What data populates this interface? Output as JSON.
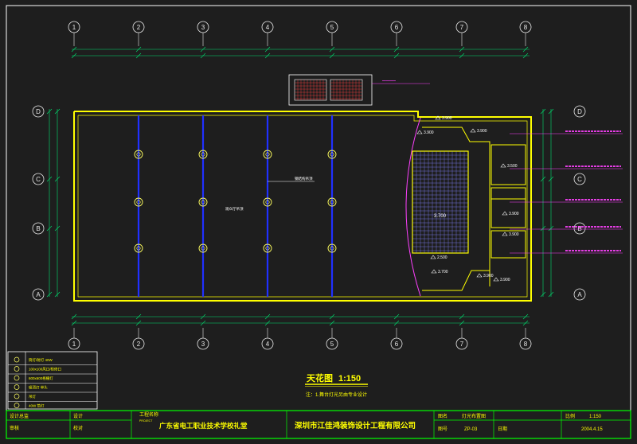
{
  "colors": {
    "background": "#1e1e1e",
    "frame": "#ffffff",
    "axis": "#e8e8e8",
    "wall": "#ffff00",
    "beam": "#2030ff",
    "dimension": "#00e070",
    "annotation": "#ff40ff",
    "titleblock": "#00ff00",
    "text": "#ffff00",
    "light": "#ffff60",
    "grid": "#8080ff"
  },
  "grid_axes": {
    "columns": [
      "1",
      "2",
      "3",
      "4",
      "5",
      "6",
      "7",
      "8"
    ],
    "rows": [
      "D",
      "C",
      "B",
      "A"
    ]
  },
  "title": {
    "main": "天花图",
    "scale": "1:150",
    "note": "注：1.舞台灯光另由专业设计"
  },
  "room_labels": {
    "hall": "观众厅吊顶",
    "beam_note": "钢结构吊顶",
    "stage_grid": "3.700"
  },
  "elevations": [
    "3.900",
    "3.900",
    "3.500",
    "3.900",
    "3.900",
    "3.700",
    "2.500",
    "3.900",
    "3.900",
    "3.900"
  ],
  "legend": [
    {
      "symbol": "circle-cross",
      "text": "筒灯/射灯 40W"
    },
    {
      "symbol": "cross",
      "text": "100x100风口/检修口"
    },
    {
      "symbol": "square",
      "text": "600x600格栅灯"
    },
    {
      "symbol": "sun",
      "text": "吸顶灯 单头"
    },
    {
      "symbol": "ring",
      "text": "吊灯"
    },
    {
      "symbol": "dot",
      "text": "40W 筒灯"
    }
  ],
  "titleblock": {
    "design_label": "设计总监",
    "design_sub": "审核",
    "check_label": "设计",
    "check_sub": "校对",
    "project_label": "工程名称",
    "project_name_small": "PROJECT",
    "project_name": "广东省电工职业技术学校礼堂",
    "company": "深圳市江佳鸿装饰设计工程有限公司",
    "drawing_label": "图名",
    "drawing_name": "灯光布置图",
    "drawing_no_label": "图号",
    "drawing_no": "ZP-03",
    "scale_label": "比例",
    "scale": "1:150",
    "date_label": "日期",
    "date": "2004.4.15"
  }
}
